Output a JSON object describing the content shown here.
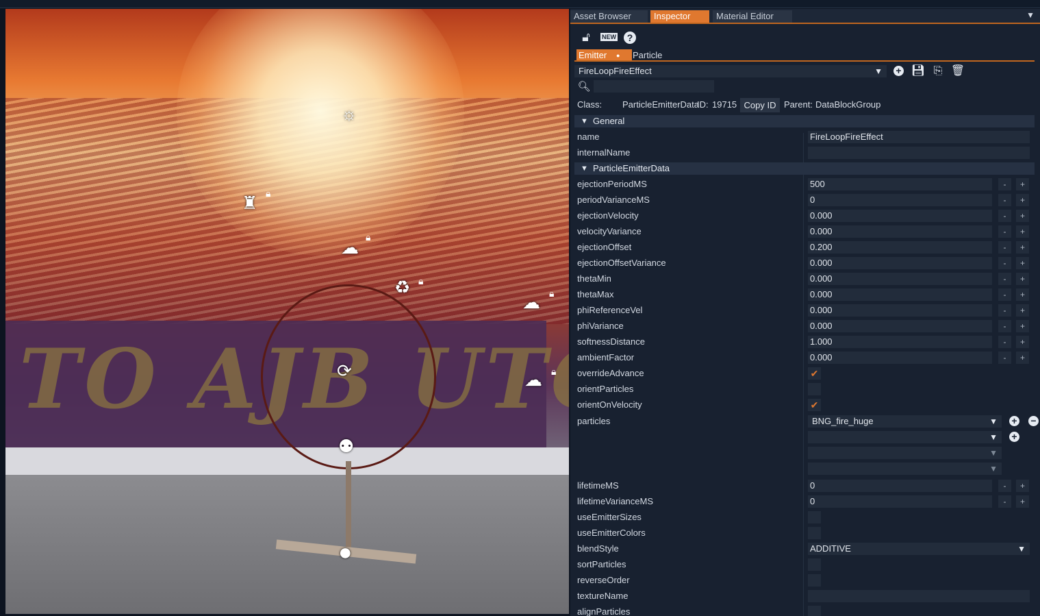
{
  "tabs": [
    "Asset Browser",
    "Inspector",
    "Material Editor"
  ],
  "active_tab": "Inspector",
  "toolbar": {
    "new_label": "NEW",
    "help_label": "?"
  },
  "subtabs": [
    "Emitter",
    "Particle"
  ],
  "datablock_select": "FireLoopFireEffect",
  "search": {
    "value": ""
  },
  "info": {
    "class_label": "Class:",
    "class_value": "ParticleEmitterData",
    "id_label": "ID:",
    "id_value": "19715",
    "copy_id": "Copy ID",
    "parent_label": "Parent:",
    "parent_value": "DataBlockGroup"
  },
  "sections": {
    "general": "General",
    "emitter": "ParticleEmitterData"
  },
  "props": {
    "name": {
      "label": "name",
      "value": "FireLoopFireEffect"
    },
    "internalName": {
      "label": "internalName",
      "value": ""
    },
    "ejectionPeriodMS": {
      "label": "ejectionPeriodMS",
      "value": "500"
    },
    "periodVarianceMS": {
      "label": "periodVarianceMS",
      "value": "0"
    },
    "ejectionVelocity": {
      "label": "ejectionVelocity",
      "value": "0.000"
    },
    "velocityVariance": {
      "label": "velocityVariance",
      "value": "0.000"
    },
    "ejectionOffset": {
      "label": "ejectionOffset",
      "value": "0.200"
    },
    "ejectionOffsetVariance": {
      "label": "ejectionOffsetVariance",
      "value": "0.000"
    },
    "thetaMin": {
      "label": "thetaMin",
      "value": "0.000"
    },
    "thetaMax": {
      "label": "thetaMax",
      "value": "0.000"
    },
    "phiReferenceVel": {
      "label": "phiReferenceVel",
      "value": "0.000"
    },
    "phiVariance": {
      "label": "phiVariance",
      "value": "0.000"
    },
    "softnessDistance": {
      "label": "softnessDistance",
      "value": "1.000"
    },
    "ambientFactor": {
      "label": "ambientFactor",
      "value": "0.000"
    },
    "overrideAdvance": {
      "label": "overrideAdvance",
      "checked": true
    },
    "orientParticles": {
      "label": "orientParticles",
      "checked": false
    },
    "orientOnVelocity": {
      "label": "orientOnVelocity",
      "checked": true
    },
    "particles": {
      "label": "particles",
      "values": [
        "BNG_fire_huge",
        "",
        "",
        ""
      ]
    },
    "lifetimeMS": {
      "label": "lifetimeMS",
      "value": "0"
    },
    "lifetimeVarianceMS": {
      "label": "lifetimeVarianceMS",
      "value": "0"
    },
    "useEmitterSizes": {
      "label": "useEmitterSizes",
      "checked": false
    },
    "useEmitterColors": {
      "label": "useEmitterColors",
      "checked": false
    },
    "blendStyle": {
      "label": "blendStyle",
      "value": "ADDITIVE"
    },
    "sortParticles": {
      "label": "sortParticles",
      "checked": false
    },
    "reverseOrder": {
      "label": "reverseOrder",
      "checked": false
    },
    "textureName": {
      "label": "textureName",
      "value": ""
    },
    "alignParticles": {
      "label": "alignParticles"
    }
  },
  "spin": {
    "minus": "-",
    "plus": "+"
  },
  "icons": {
    "lock": "lock-icon",
    "new": "new-icon",
    "help": "help-icon",
    "add": "add-circle-icon",
    "save": "save-icon",
    "save_as": "save-as-icon",
    "delete": "trash-icon",
    "search": "search-icon",
    "dropdown": "caret-down-icon"
  },
  "colors": {
    "accent": "#e0782f",
    "panel_bg": "#182130",
    "field_bg": "#222c3b",
    "section_bg": "#263143"
  }
}
